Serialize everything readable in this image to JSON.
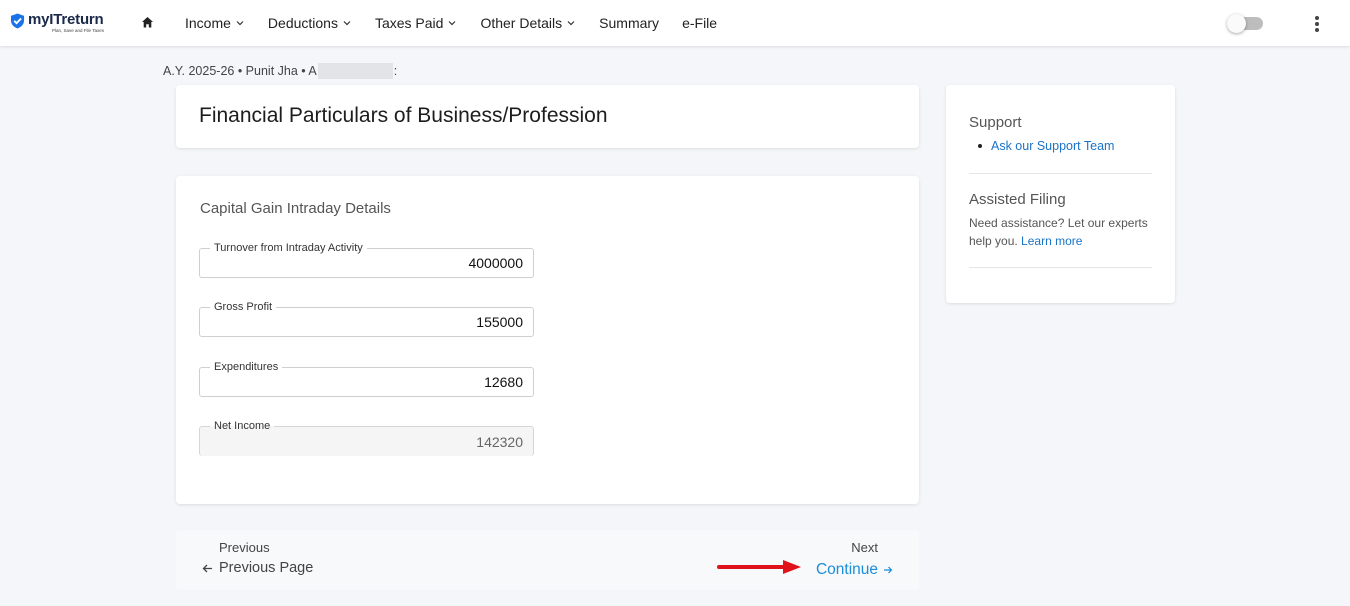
{
  "app": {
    "logo_name": "myITreturn",
    "logo_tagline": "Plan, Save and File Taxes",
    "accent_color": "#1a8ed8"
  },
  "nav": {
    "home_icon": "home-icon",
    "items": [
      {
        "label": "Income",
        "has_dropdown": true
      },
      {
        "label": "Deductions",
        "has_dropdown": true
      },
      {
        "label": "Taxes Paid",
        "has_dropdown": true
      },
      {
        "label": "Other Details",
        "has_dropdown": true
      },
      {
        "label": "Summary",
        "has_dropdown": false
      },
      {
        "label": "e-File",
        "has_dropdown": false
      }
    ],
    "toggle_on": false,
    "menu_icon": "more-vertical-icon"
  },
  "breadcrumb": {
    "prefix": "A.Y. 2025-26 • Punit Jha • A",
    "suffix": ":"
  },
  "page": {
    "title": "Financial Particulars of Business/Profession"
  },
  "form": {
    "section_title": "Capital Gain Intraday Details",
    "fields": [
      {
        "label": "Turnover from Intraday Activity",
        "value": "4000000",
        "readonly": false
      },
      {
        "label": "Gross Profit",
        "value": "155000",
        "readonly": false
      },
      {
        "label": "Expenditures",
        "value": "12680",
        "readonly": false
      },
      {
        "label": "Net Income",
        "value": "142320",
        "readonly": true
      }
    ]
  },
  "support": {
    "title": "Support",
    "link": "Ask our Support Team",
    "assisted_title": "Assisted Filing",
    "assisted_text": "Need assistance? Let our experts help you.",
    "learn_more": "Learn more"
  },
  "pager": {
    "previous_label": "Previous",
    "previous_link": "Previous Page",
    "next_label": "Next",
    "next_link": "Continue"
  },
  "annotation": {
    "arrow_color": "#e0131a"
  }
}
